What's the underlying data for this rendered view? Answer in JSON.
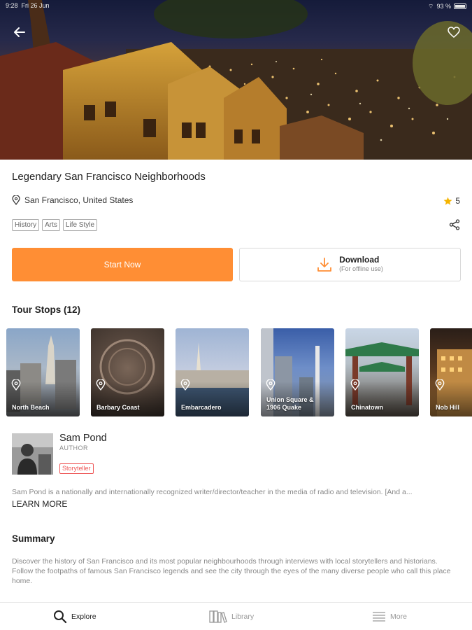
{
  "status_bar": {
    "time": "9:28",
    "date": "Fri 26 Jun",
    "battery": "93 %"
  },
  "hero": {
    "alt_scene": "city-night-skyline"
  },
  "tour": {
    "title": "Legendary San Francisco Neighborhoods",
    "location": "San Francisco, United States",
    "rating": "5",
    "tags": [
      "History",
      "Arts",
      "Life Style"
    ]
  },
  "actions": {
    "start_label": "Start Now",
    "download_label": "Download",
    "download_sub": "(For offline use)"
  },
  "stops_section": {
    "heading": "Tour Stops (12)",
    "stops": [
      {
        "name": "North Beach"
      },
      {
        "name": "Barbary Coast"
      },
      {
        "name": "Embarcadero"
      },
      {
        "name": "Union Square &\n1906 Quake"
      },
      {
        "name": "Chinatown"
      },
      {
        "name": "Nob Hill"
      }
    ]
  },
  "author": {
    "name": "Sam Pond",
    "role": "AUTHOR",
    "badge": "Storyteller",
    "bio": "Sam Pond is a nationally and internationally recognized writer/director/teacher in the media of radio and television. [And a...",
    "learn_more": "LEARN MORE"
  },
  "summary": {
    "heading": "Summary",
    "text": "Discover the history of San Francisco and its most popular neighbourhoods through interviews with local storytellers and historians. Follow the footpaths of famous San Francisco legends and see the city through the eyes of the many diverse people who call this place home."
  },
  "tabbar": {
    "tabs": [
      {
        "label": "Explore",
        "active": true
      },
      {
        "label": "Library",
        "active": false
      },
      {
        "label": "More",
        "active": false
      }
    ]
  },
  "colors": {
    "accent": "#ff8e34",
    "star": "#f5b400",
    "badge": "#e55555"
  }
}
